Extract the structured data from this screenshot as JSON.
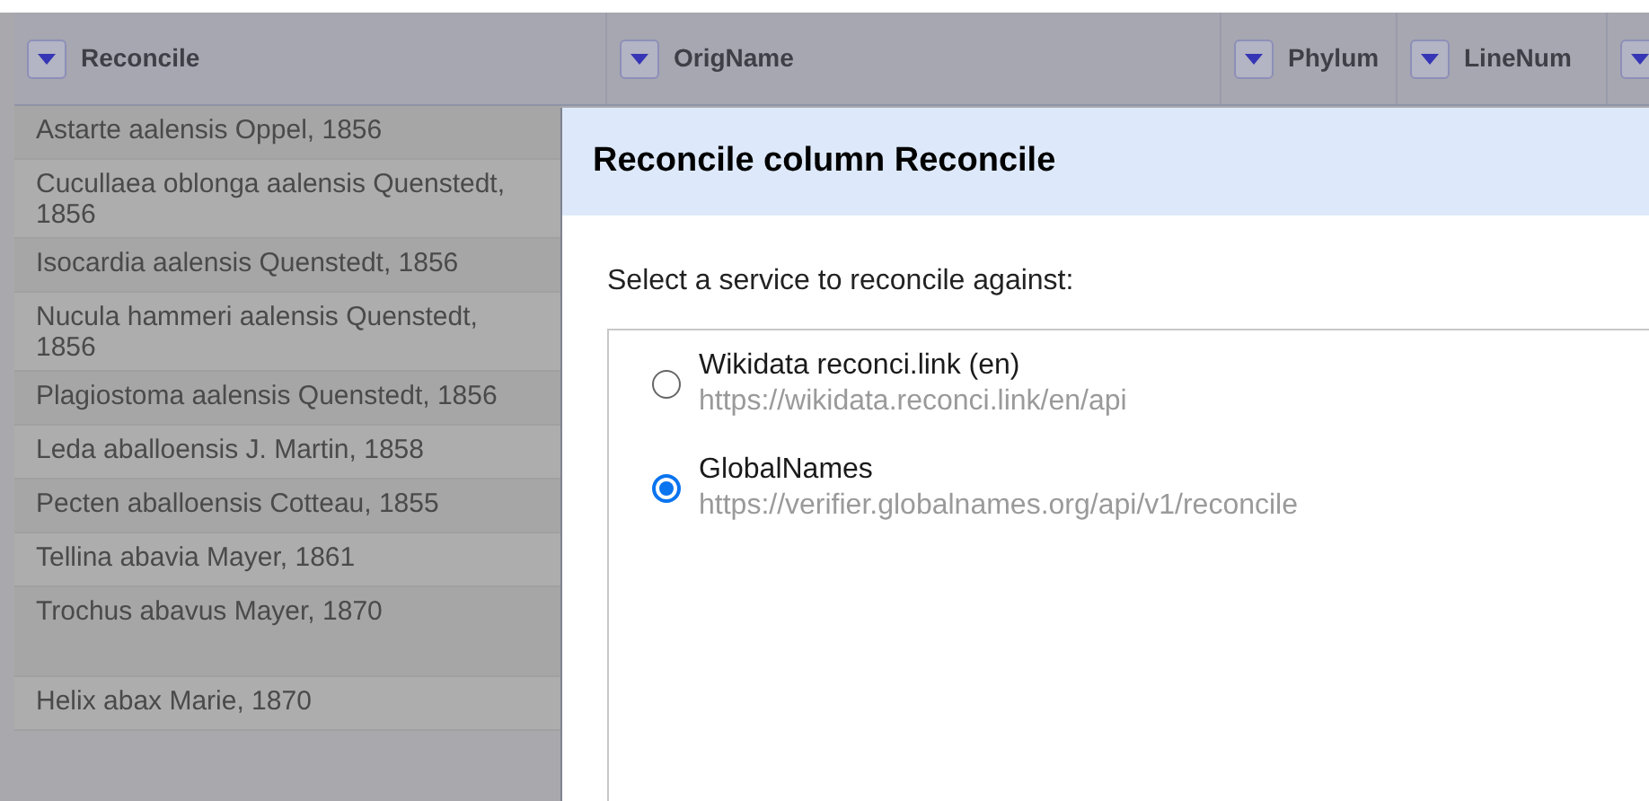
{
  "table": {
    "columns": [
      {
        "label": "Reconcile"
      },
      {
        "label": "OrigName"
      },
      {
        "label": "Phylum"
      },
      {
        "label": "LineNum"
      },
      {}
    ],
    "rows": [
      {
        "cell": "Astarte aalensis Oppel, 1856"
      },
      {
        "cell": "Cucullaea oblonga aalensis Quenstedt, 1856"
      },
      {
        "cell": "Isocardia aalensis Quenstedt, 1856"
      },
      {
        "cell": "Nucula hammeri aalensis Quenstedt, 1856"
      },
      {
        "cell": "Plagiostoma aalensis Quenstedt, 1856"
      },
      {
        "cell": "Leda aballoensis J. Martin, 1858"
      },
      {
        "cell": "Pecten aballoensis Cotteau, 1855"
      },
      {
        "cell": "Tellina abavia Mayer, 1861"
      },
      {
        "cell": "Trochus abavus Mayer, 1870",
        "tall": true
      },
      {
        "cell": "Helix abax Marie, 1870"
      }
    ]
  },
  "dialog": {
    "title": "Reconcile column Reconcile",
    "prompt": "Select a service to reconcile against:",
    "services": [
      {
        "name": "Wikidata reconci.link (en)",
        "url": "https://wikidata.reconci.link/en/api",
        "selected": false
      },
      {
        "name": "GlobalNames",
        "url": "https://verifier.globalnames.org/api/v1/reconcile",
        "selected": true
      }
    ]
  }
}
